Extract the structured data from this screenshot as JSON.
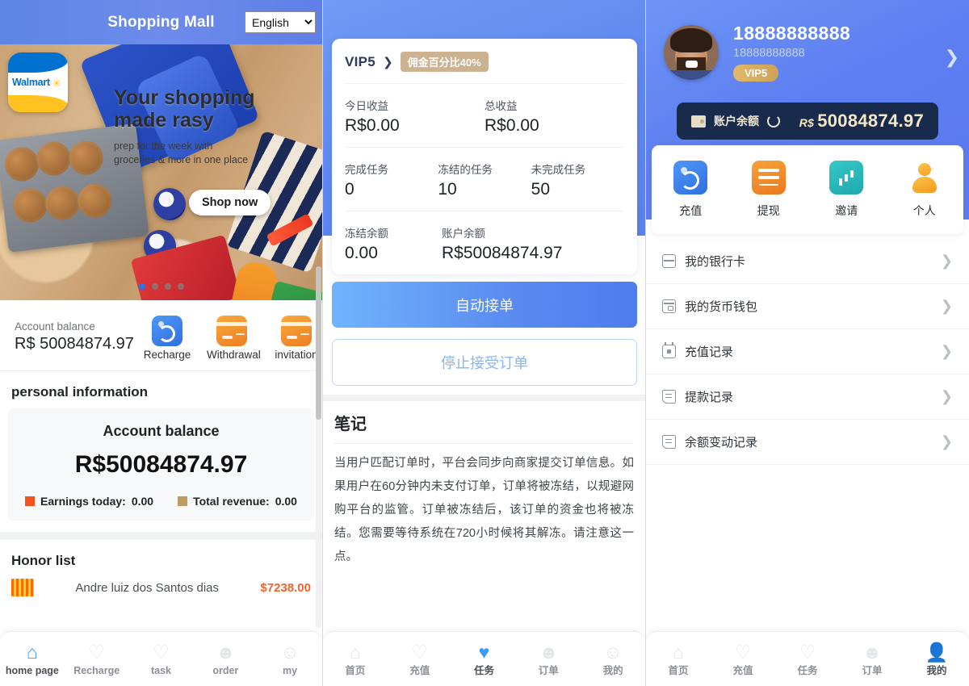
{
  "panel_left": {
    "header": {
      "title": "Shopping Mall",
      "language_selected": "English",
      "language_options": [
        "English"
      ]
    },
    "banner": {
      "brand": "Walmart",
      "headline_line1": "Your shopping",
      "headline_line2": "made rasy",
      "subline1": "prep for the week with",
      "subline2": "groceries & more in one place",
      "cta": "Shop now",
      "dots_total": 4,
      "dot_active_index": 0
    },
    "balance_strip": {
      "label": "Account balance",
      "value": "R$ 50084874.97",
      "actions": [
        {
          "icon": "wallet-icon",
          "label": "Recharge"
        },
        {
          "icon": "card-icon",
          "label": "Withdrawal"
        },
        {
          "icon": "card-icon",
          "label": "invitation"
        }
      ]
    },
    "personal_information": {
      "section_title": "personal information",
      "card_title": "Account balance",
      "amount": "R$50084874.97",
      "stats": [
        {
          "label": "Earnings today:",
          "value": "0.00",
          "color": "#f4511e"
        },
        {
          "label": "Total revenue:",
          "value": "0.00",
          "color": "#c19a62"
        }
      ]
    },
    "honor": {
      "title": "Honor list",
      "rows": [
        {
          "name": "Andre luiz dos Santos dias",
          "amount": "$7238.00"
        }
      ]
    },
    "tabbar": [
      {
        "icon": "home-icon",
        "label": "home page",
        "active": true
      },
      {
        "icon": "recharge-icon",
        "label": "Recharge",
        "active": false
      },
      {
        "icon": "task-icon",
        "label": "task",
        "active": false
      },
      {
        "icon": "order-icon",
        "label": "order",
        "active": false
      },
      {
        "icon": "profile-icon",
        "label": "my",
        "active": false
      }
    ]
  },
  "panel_middle": {
    "vip": {
      "level": "VIP5",
      "commission_badge": "佣金百分比40%"
    },
    "stats_row1": [
      {
        "label": "今日收益",
        "value": "R$0.00"
      },
      {
        "label": "总收益",
        "value": "R$0.00"
      }
    ],
    "stats_row2": [
      {
        "label": "完成任务",
        "value": "0"
      },
      {
        "label": "冻结的任务",
        "value": "10"
      },
      {
        "label": "未完成任务",
        "value": "50"
      }
    ],
    "stats_row3": [
      {
        "label": "冻结余额",
        "value": "0.00"
      },
      {
        "label": "账户余额",
        "value": "R$50084874.97"
      }
    ],
    "primary_button": "自动接单",
    "ghost_button": "停止接受订单",
    "notes": {
      "title": "笔记",
      "body": "当用户匹配订单时，平台会同步向商家提交订单信息。如果用户在60分钟内未支付订单，订单将被冻结，以规避网购平台的监管。订单被冻结后，该订单的资金也将被冻结。您需要等待系统在720小时候将其解冻。请注意这一点。"
    },
    "tabbar": [
      {
        "icon": "home-icon",
        "label": "首页",
        "active": false
      },
      {
        "icon": "recharge-icon",
        "label": "充值",
        "active": false
      },
      {
        "icon": "task-icon",
        "label": "任务",
        "active": true
      },
      {
        "icon": "order-icon",
        "label": "订单",
        "active": false
      },
      {
        "icon": "profile-icon",
        "label": "我的",
        "active": false
      }
    ]
  },
  "panel_right": {
    "user": {
      "name": "18888888888",
      "sub": "18888888888",
      "vip_badge": "VIP5"
    },
    "balance_bar": {
      "icon": "wallet-icon",
      "label": "账户余额",
      "refresh_icon": "refresh-icon",
      "currency": "R$",
      "amount": "50084874.97"
    },
    "quick_actions": [
      {
        "icon": "recharge-icon",
        "label": "充值"
      },
      {
        "icon": "withdraw-icon",
        "label": "提现"
      },
      {
        "icon": "invite-icon",
        "label": "邀请"
      },
      {
        "icon": "person-icon",
        "label": "个人"
      }
    ],
    "menu": [
      {
        "icon": "bank-card-icon",
        "label": "我的银行卡"
      },
      {
        "icon": "wallet-icon",
        "label": "我的货币钱包"
      },
      {
        "icon": "calendar-icon",
        "label": "充值记录"
      },
      {
        "icon": "document-icon",
        "label": "提款记录"
      },
      {
        "icon": "document-icon",
        "label": "余额变动记录"
      }
    ],
    "tabbar": [
      {
        "icon": "home-icon",
        "label": "首页",
        "active": false
      },
      {
        "icon": "recharge-icon",
        "label": "充值",
        "active": false
      },
      {
        "icon": "task-icon",
        "label": "任务",
        "active": false
      },
      {
        "icon": "order-icon",
        "label": "订单",
        "active": false
      },
      {
        "icon": "profile-icon",
        "label": "我的",
        "active": true
      }
    ]
  },
  "theme": {
    "brand_blue": "#5b86e5",
    "accent_blue": "#3d9bf5",
    "gold": "#cdb291",
    "orange": "#f1642e",
    "dark_navy": "#182b4d"
  }
}
